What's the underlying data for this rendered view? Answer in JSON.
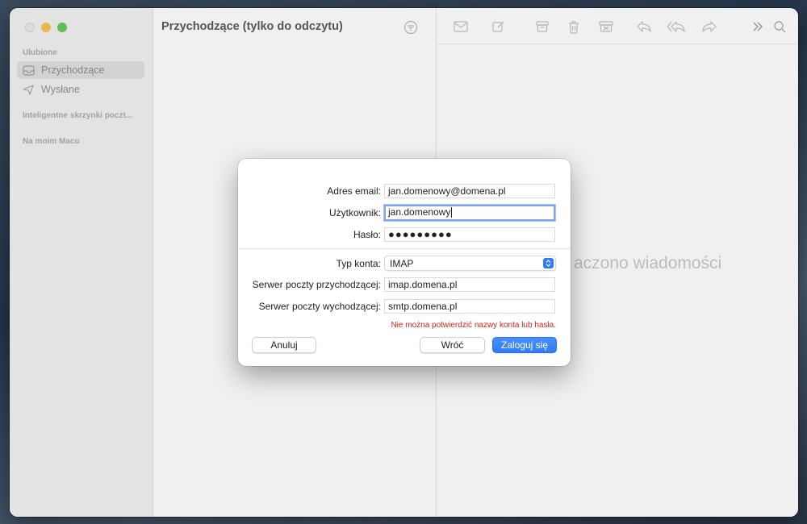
{
  "sidebar": {
    "section_favorites": "Ulubione",
    "items": [
      {
        "label": "Przychodzące",
        "icon": "tray-icon"
      },
      {
        "label": "Wysłane",
        "icon": "paper-plane-icon"
      }
    ],
    "section_smart": "Inteligentne skrzynki poczt...",
    "section_mac": "Na moim Macu"
  },
  "list": {
    "title": "Przychodzące (tylko do odczytu)"
  },
  "content": {
    "no_message_text": "aczono wiadomości",
    "toolbar_icons": [
      "envelope-icon",
      "compose-icon",
      "archive-icon",
      "trash-icon",
      "junk-icon",
      "reply-icon",
      "reply-all-icon",
      "forward-icon",
      "more-icon",
      "search-icon"
    ]
  },
  "dialog": {
    "email_label": "Adres email:",
    "email_value": "jan.domenowy@domena.pl",
    "user_label": "Użytkownik:",
    "user_value": "jan.domenowy",
    "password_label": "Hasło:",
    "password_value": "●●●●●●●●●",
    "account_type_label": "Typ konta:",
    "account_type_value": "IMAP",
    "incoming_label": "Serwer poczty przychodzącej:",
    "incoming_value": "imap.domena.pl",
    "outgoing_label": "Serwer poczty wychodzącej:",
    "outgoing_value": "smtp.domena.pl",
    "error": "Nie można potwierdzić nazwy konta lub hasła.",
    "cancel": "Anuluj",
    "back": "Wróć",
    "login": "Zaloguj się"
  },
  "colors": {
    "accent": "#2f7cf6",
    "error": "#d0251b"
  }
}
